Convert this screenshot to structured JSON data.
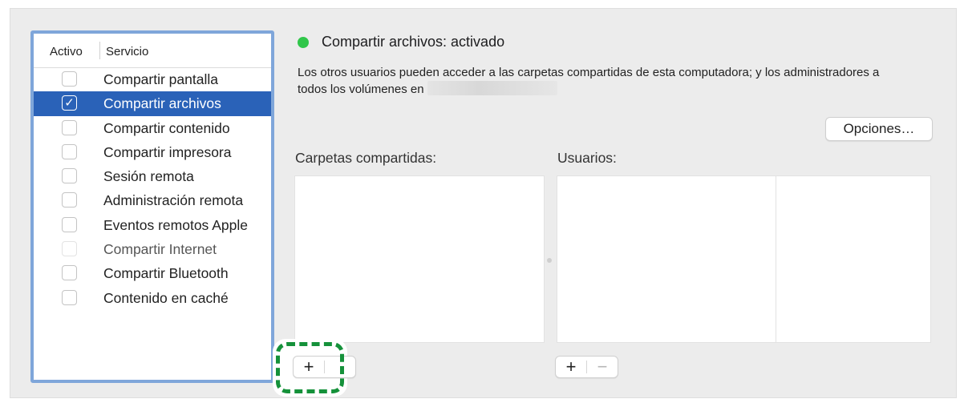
{
  "services": {
    "header_active": "Activo",
    "header_service": "Servicio",
    "items": [
      {
        "label": "Compartir pantalla",
        "checked": false,
        "selected": false,
        "disabled": false
      },
      {
        "label": "Compartir archivos",
        "checked": true,
        "selected": true,
        "disabled": false
      },
      {
        "label": "Compartir contenido",
        "checked": false,
        "selected": false,
        "disabled": false
      },
      {
        "label": "Compartir impresora",
        "checked": false,
        "selected": false,
        "disabled": false
      },
      {
        "label": "Sesión remota",
        "checked": false,
        "selected": false,
        "disabled": false
      },
      {
        "label": "Administración remota",
        "checked": false,
        "selected": false,
        "disabled": false
      },
      {
        "label": "Eventos remotos Apple",
        "checked": false,
        "selected": false,
        "disabled": false
      },
      {
        "label": "Compartir Internet",
        "checked": false,
        "selected": false,
        "disabled": true
      },
      {
        "label": "Compartir Bluetooth",
        "checked": false,
        "selected": false,
        "disabled": false
      },
      {
        "label": "Contenido en caché",
        "checked": false,
        "selected": false,
        "disabled": false
      }
    ]
  },
  "detail": {
    "status_title": "Compartir archivos: activado",
    "description": "Los otros usuarios pueden acceder a las carpetas compartidas de esta computadora; y los administradores a todos los volúmenes en",
    "options_label": "Opciones…",
    "shared_folders_label": "Carpetas compartidas:",
    "users_label": "Usuarios:",
    "add_symbol": "+",
    "remove_symbol": "−"
  },
  "colors": {
    "status_on": "#30c64a",
    "selection": "#2a62b8",
    "highlight": "#15913a"
  },
  "icons": {
    "checkmark": "✓"
  }
}
